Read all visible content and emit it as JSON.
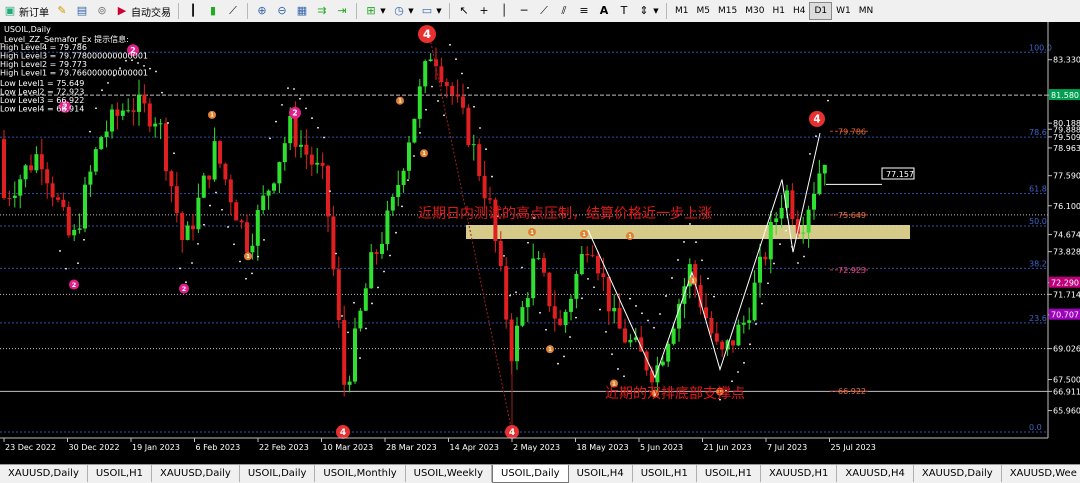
{
  "toolbar": {
    "new_order": "新订单",
    "auto_trading": "自动交易",
    "timeframes": [
      "M1",
      "M5",
      "M15",
      "M30",
      "H1",
      "H4",
      "D1",
      "W1",
      "MN"
    ],
    "active_timeframe": "D1"
  },
  "chart": {
    "symbol_title": "USOIL,Daily",
    "indicator_title": "_Level_ZZ_Semafor_Ex 提示信息:",
    "info_lines": [
      "High Level4 = 79.786",
      "High Level3 = 79.778000000000001",
      "High Level2 = 79.773",
      "High Level1 = 79.766000000000001",
      "Low Level1 = 75.649",
      "Low Level2 = 72.923",
      "Low Level3 = 66.922",
      "Low Level4 = 66.914"
    ],
    "annotation_resistance": "近期日内测试的高点压制，结算价格近一步上涨",
    "annotation_support": "近期的双排底部支撑点",
    "price_axis": [
      "83.330",
      "81.580",
      "80.188",
      "79.888",
      "79.509",
      "78.963",
      "77.590",
      "76.100",
      "74.674",
      "73.828",
      "72.290",
      "71.714",
      "70.700",
      "69.026",
      "67.500",
      "66.911",
      "65.960"
    ],
    "price_highlights": [
      {
        "text": "81.580",
        "color": "#00a050"
      },
      {
        "text": "72.290",
        "color": "#c0007a"
      },
      {
        "text": "70.707",
        "color": "#a000c0"
      }
    ],
    "fib_labels": [
      "100.0",
      "78.6",
      "61.8",
      "50.0",
      "38.2",
      "23.6",
      "0.0"
    ],
    "level_labels": [
      "79.786",
      "75.649",
      "72.923",
      "66.922"
    ],
    "box_label": "77.157",
    "dates": [
      "23 Dec 2022",
      "30 Dec 2022",
      "19 Jan 2023",
      "6 Feb 2023",
      "22 Feb 2023",
      "10 Mar 2023",
      "28 Mar 2023",
      "14 Apr 2023",
      "2 May 2023",
      "18 May 2023",
      "5 Jun 2023",
      "21 Jun 2023",
      "7 Jul 2023",
      "25 Jul 2023"
    ],
    "semafor": [
      {
        "label": "4",
        "color": "#e83030"
      },
      {
        "label": "2",
        "color": "#e0208a"
      },
      {
        "label": "1",
        "color": "#e08030"
      }
    ]
  },
  "tabs": [
    "XAUUSD,Daily",
    "USOIL,H1",
    "XAUUSD,Daily",
    "USOIL,Daily",
    "USOIL,Monthly",
    "USOIL,Weekly",
    "USOIL,Daily",
    "USOIL,H4",
    "USOIL,H1",
    "USOIL,H1",
    "XAUUSD,H1",
    "XAUUSD,H4",
    "XAUUSD,Daily",
    "XAUUSD,Wee"
  ],
  "active_tab": 6,
  "colors": {
    "bull": "#30e030",
    "bear": "#e02020",
    "zone": "#f2e69a"
  }
}
